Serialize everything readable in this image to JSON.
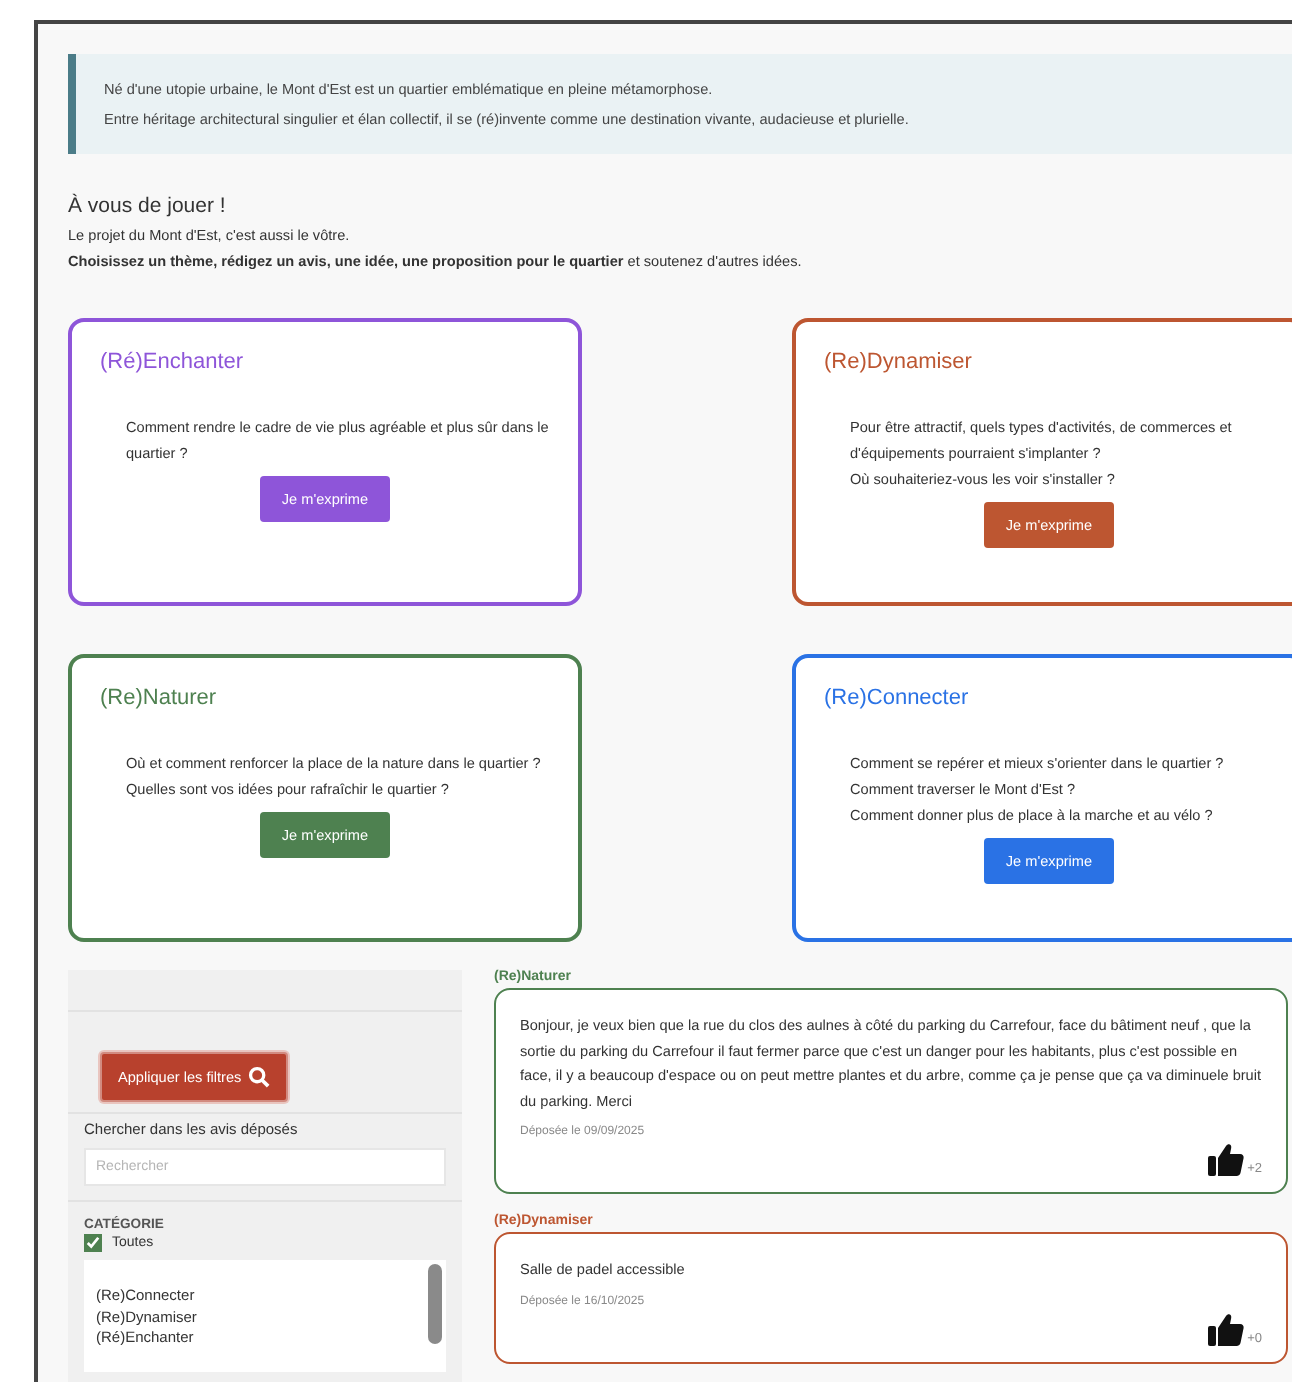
{
  "intro": {
    "lines": [
      "Né d'une utopie urbaine, le Mont d'Est est un quartier emblématique en pleine métamorphose.",
      "Entre héritage architectural singulier et élan collectif, il se (ré)invente comme une destination vivante, audacieuse et plurielle."
    ]
  },
  "call": {
    "heading": "À vous de jouer !",
    "lines": [
      "Le projet du Mont d'Est, c'est aussi le vôtre.",
      "**Choisissez un thème, rédigez un avis, une idée, une proposition pour le quartier** et soutenez d'autres idées."
    ]
  },
  "themes": [
    {
      "title": "(Ré)Enchanter",
      "color": "#8e55d9",
      "questions": [
        "Comment rendre le cadre de vie plus agréable et plus sûr dans le quartier ?"
      ],
      "button": "Je m'exprime"
    },
    {
      "title": "(Re)Dynamiser",
      "color": "#bd5631",
      "questions": [
        "Pour être attractif, quels types d'activités, de commerces et d'équipements pourraient s'implanter ?",
        "Où souhaiteriez-vous les voir s'installer ?"
      ],
      "button": "Je m'exprime"
    },
    {
      "title": "(Re)Naturer",
      "color": "#4e8150",
      "questions": [
        "Où et comment renforcer la place de la nature dans le quartier ?",
        "Quelles sont vos idées pour rafraîchir le quartier ?"
      ],
      "button": "Je m'exprime"
    },
    {
      "title": "(Re)Connecter",
      "color": "#2a72e5",
      "questions": [
        "Comment se repérer et mieux s'orienter dans le quartier ?",
        "Comment traverser le Mont d'Est ?",
        "Comment donner plus de place à la marche et au vélo ?"
      ],
      "button": "Je m'exprime"
    }
  ],
  "filters": {
    "apply_button": "Appliquer les filtres",
    "search_label": "Chercher dans les avis déposés",
    "search_placeholder": "Rechercher",
    "category_label": "CATÉGORIE",
    "all": {
      "label": "Toutes",
      "checked": true
    },
    "categories": [
      "(Re)Connecter",
      "(Re)Dynamiser",
      "(Ré)Enchanter"
    ]
  },
  "reviews": [
    {
      "theme": "(Re)Naturer",
      "color": "#4e8150",
      "text": "Bonjour, je veux bien que la rue du clos des aulnes à côté du parking du Carrefour, face du bâtiment neuf , que la sortie du parking du Carrefour il faut fermer parce que c'est un danger pour les habitants, plus c'est possible en face, il y a beaucoup d'espace ou on peut mettre plantes et du arbre, comme ça je pense que ça va diminuele bruit du parking. Merci",
      "date": "Déposée le 09/09/2025",
      "votes": "+2"
    },
    {
      "theme": "(Re)Dynamiser",
      "color": "#bd5631",
      "text": "Salle de padel accessible",
      "date": "Déposée le 16/10/2025",
      "votes": "+0"
    }
  ]
}
